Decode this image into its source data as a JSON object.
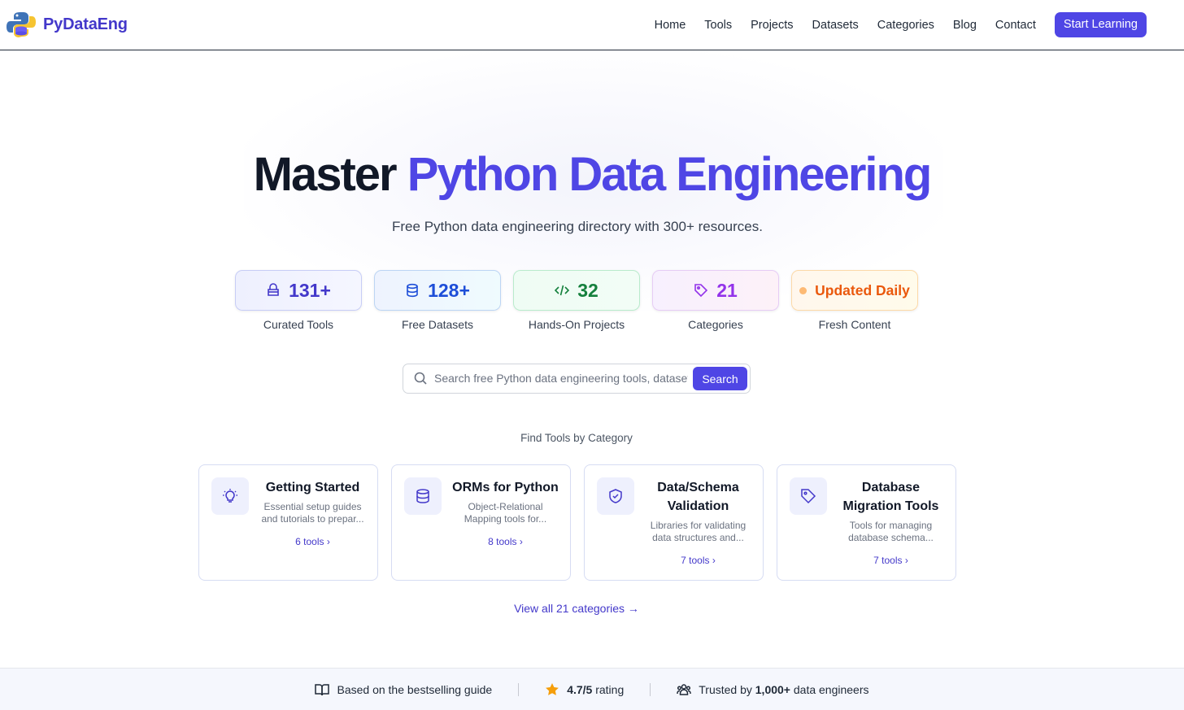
{
  "brand": {
    "name": "PyDataEng"
  },
  "nav": {
    "links": [
      "Home",
      "Tools",
      "Projects",
      "Datasets",
      "Categories",
      "Blog",
      "Contact"
    ],
    "cta": "Start Learning"
  },
  "hero": {
    "title_plain": "Master",
    "title_accent": "Python Data Engineering",
    "subtitle": "Free Python data engineering directory with 300+ resources."
  },
  "stats": [
    {
      "value": "131+",
      "label": "Curated Tools",
      "icon": "box-icon"
    },
    {
      "value": "128+",
      "label": "Free Datasets",
      "icon": "database-icon"
    },
    {
      "value": "32",
      "label": "Hands-On Projects",
      "icon": "code-icon"
    },
    {
      "value": "21",
      "label": "Categories",
      "icon": "tag-icon"
    },
    {
      "value": "Updated Daily",
      "label": "Fresh Content",
      "icon": "dot-icon"
    }
  ],
  "search": {
    "placeholder": "Search free Python data engineering tools, datasets",
    "button": "Search"
  },
  "categories": {
    "heading": "Find Tools by Category",
    "items": [
      {
        "title": "Getting Started",
        "desc": "Essential setup guides and tutorials to prepar...",
        "count": "6 tools",
        "icon": "lightbulb-icon"
      },
      {
        "title": "ORMs for Python",
        "desc": "Object-Relational Mapping tools for...",
        "count": "8 tools",
        "icon": "database-icon"
      },
      {
        "title": "Data/Schema Validation",
        "desc": "Libraries for validating data structures and...",
        "count": "7 tools",
        "icon": "shield-check-icon"
      },
      {
        "title": "Database Migration Tools",
        "desc": "Tools for managing database schema...",
        "count": "7 tools",
        "icon": "tag-icon"
      }
    ],
    "view_all": "View all 21 categories →"
  },
  "trust": {
    "guide": "Based on the bestselling guide",
    "rating": "4.7/5",
    "rating_suffix": "rating",
    "trusted_prefix": "Trusted by",
    "trusted_count": "1,000+",
    "trusted_suffix": "data engineers"
  },
  "colors": {
    "accent": "#4f46e5",
    "brand": "#4338ca"
  }
}
